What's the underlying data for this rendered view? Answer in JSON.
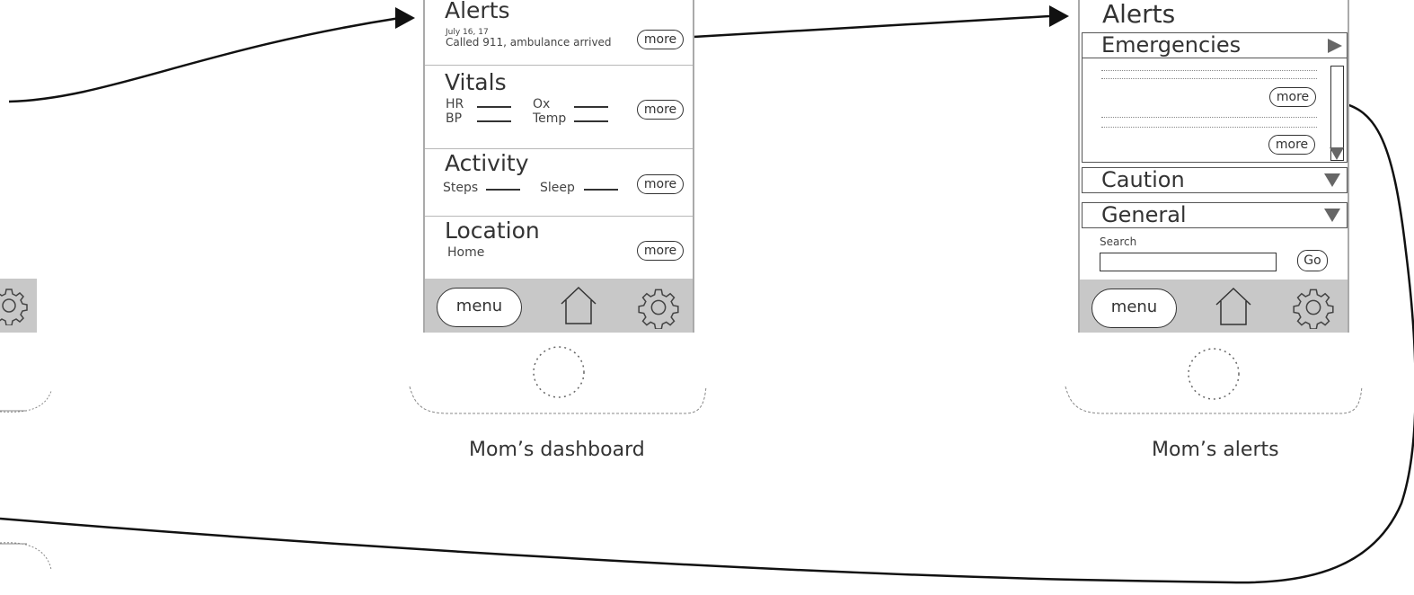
{
  "dashboard": {
    "caption": "Mom’s dashboard",
    "alerts": {
      "title": "Alerts",
      "date": "July 16, 17",
      "text": "Called 911, ambulance arrived",
      "more": "more"
    },
    "vitals": {
      "title": "Vitals",
      "hr": "HR",
      "ox": "Ox",
      "bp": "BP",
      "temp": "Temp",
      "more": "more"
    },
    "activity": {
      "title": "Activity",
      "steps": "Steps",
      "sleep": "Sleep",
      "more": "more"
    },
    "location": {
      "title": "Location",
      "value": "Home",
      "more": "more"
    },
    "nav": {
      "menu": "menu"
    }
  },
  "alerts_screen": {
    "caption": "Mom’s alerts",
    "title": "Alerts",
    "emergencies": {
      "title": "Emergencies",
      "more_1": "more",
      "more_2": "more"
    },
    "caution": {
      "title": "Caution"
    },
    "general": {
      "title": "General"
    },
    "search": {
      "label": "Search",
      "go": "Go",
      "value": ""
    },
    "nav": {
      "menu": "menu"
    }
  },
  "left_partial": {},
  "icons": [
    "arrow-head-icon",
    "home-icon",
    "gear-icon",
    "home-button-icon",
    "triangle-right-icon",
    "triangle-down-icon"
  ]
}
